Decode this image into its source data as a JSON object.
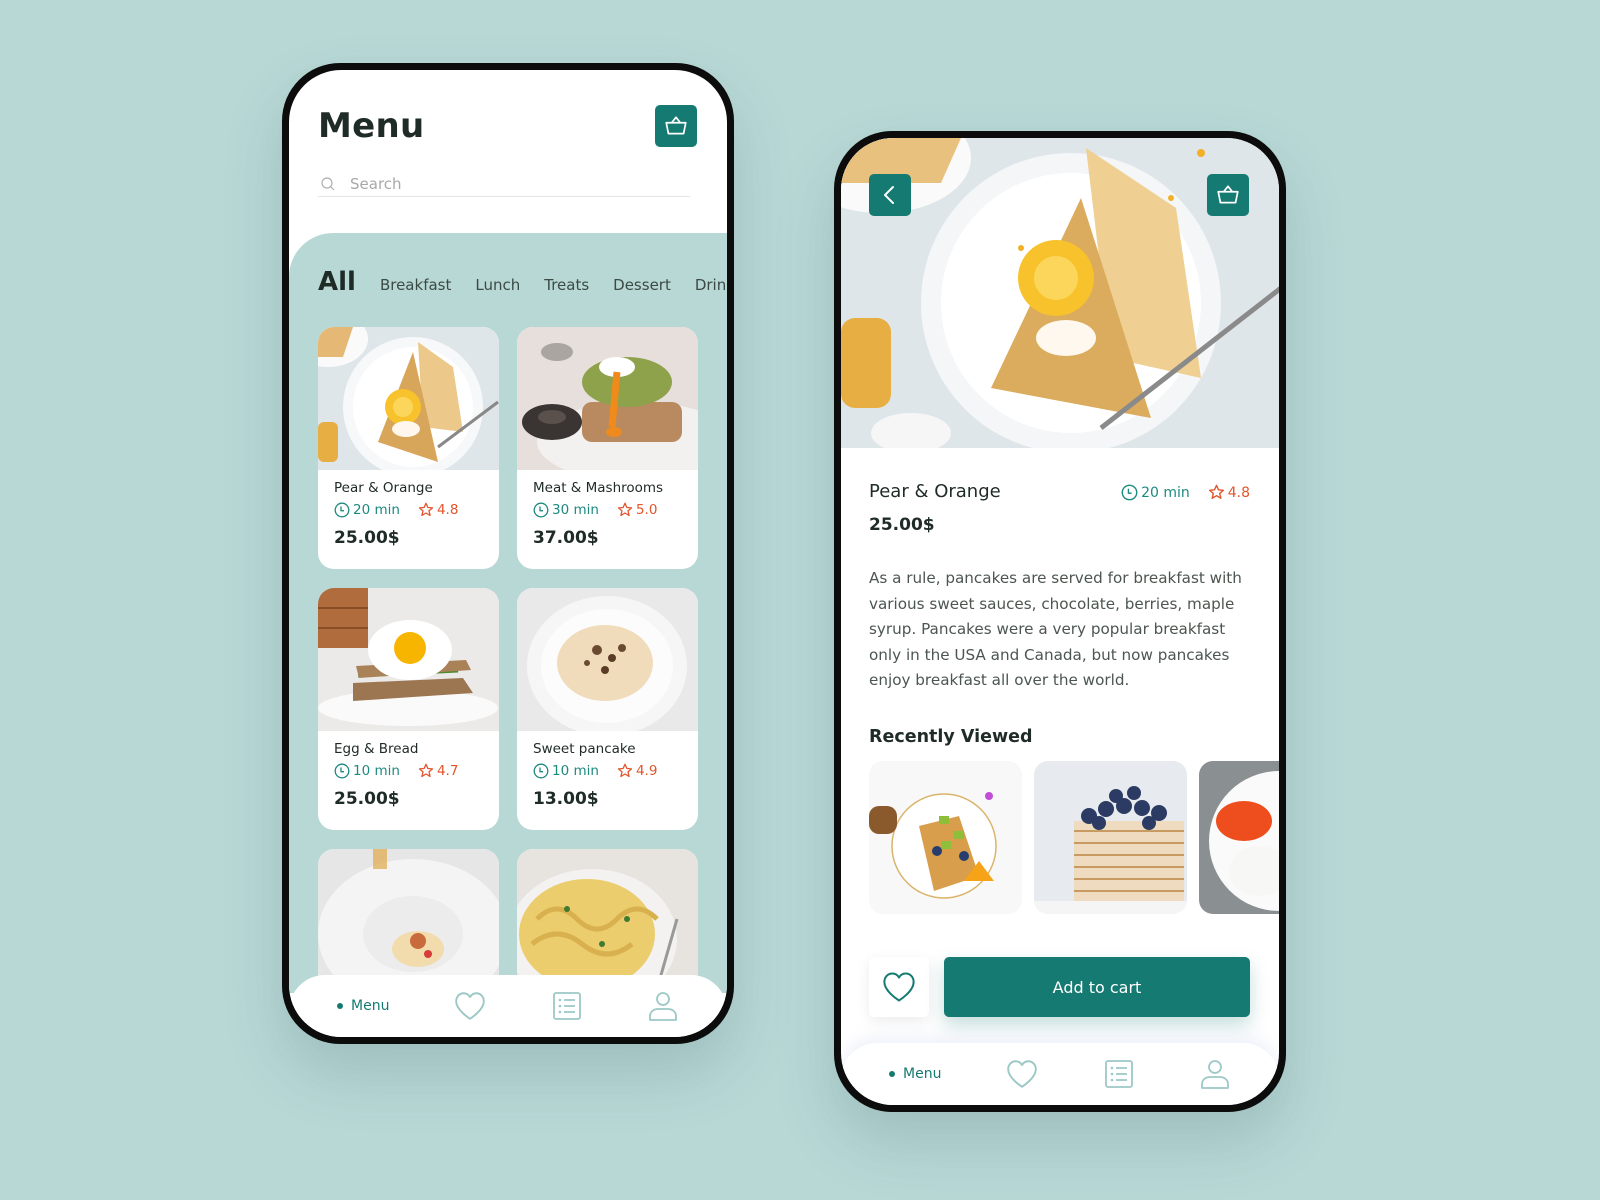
{
  "colors": {
    "background": "#b8d8d6",
    "accent": "#157a71",
    "time": "#1d8a80",
    "rating": "#e2542c",
    "text": "#1f2b26"
  },
  "menu_screen": {
    "title": "Menu",
    "basket_icon": "basket-icon",
    "search": {
      "placeholder": "Search",
      "value": ""
    },
    "categories": [
      {
        "label": "All",
        "active": true
      },
      {
        "label": "Breakfast",
        "active": false
      },
      {
        "label": "Lunch",
        "active": false
      },
      {
        "label": "Treats",
        "active": false
      },
      {
        "label": "Dessert",
        "active": false
      },
      {
        "label": "Drinks",
        "active": false
      }
    ],
    "items": [
      {
        "name": "Pear & Orange",
        "time": "20 min",
        "rating": "4.8",
        "price": "25.00$",
        "image": "crepes-with-orange"
      },
      {
        "name": "Meat & Mashrooms",
        "time": "30 min",
        "rating": "5.0",
        "price": "37.00$",
        "image": "toast-with-egg-and-mushrooms"
      },
      {
        "name": "Egg & Bread",
        "time": "10 min",
        "rating": "4.7",
        "price": "25.00$",
        "image": "egg-sandwich"
      },
      {
        "name": "Sweet pancake",
        "time": "10 min",
        "rating": "4.9",
        "price": "13.00$",
        "image": "pancake-on-plate"
      },
      {
        "name": "",
        "image": "soup-bowl"
      },
      {
        "name": "",
        "image": "pasta"
      }
    ],
    "nav": {
      "active_label": "Menu",
      "items": [
        "menu",
        "favorites-heart-icon",
        "orders-list-icon",
        "profile-icon"
      ]
    }
  },
  "detail_screen": {
    "back_icon": "chevron-left-icon",
    "basket_icon": "basket-icon",
    "hero_image": "crepes-with-orange",
    "name": "Pear & Orange",
    "time": "20 min",
    "rating": "4.8",
    "price": "25.00$",
    "description": "As a rule, pancakes are served for breakfast with various sweet sauces, chocolate, berries, maple syrup. Pancakes were a very popular breakfast only in the USA and Canada, but now pancakes enjoy breakfast all over the world.",
    "recently_viewed_title": "Recently Viewed",
    "recently_viewed": [
      "crepe-with-kiwi-blueberries",
      "pancake-stack-blueberries",
      "tomato-and-cheese"
    ],
    "add_to_cart_label": "Add to cart",
    "favorite_icon": "heart-icon",
    "nav": {
      "active_label": "Menu",
      "items": [
        "menu",
        "favorites-heart-icon",
        "orders-list-icon",
        "profile-icon"
      ]
    }
  }
}
